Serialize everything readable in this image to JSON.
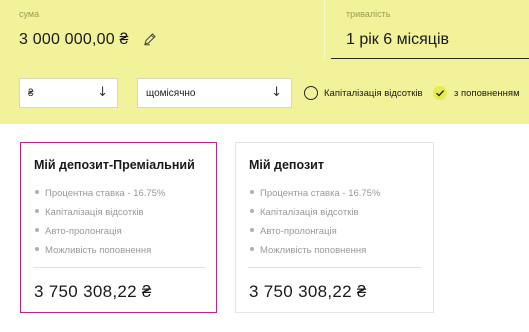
{
  "calculator": {
    "amount_label": "сума",
    "amount_value": "3 000 000,00 ₴",
    "duration_label": "тривалість",
    "duration_value": "1 рік 6 місяців",
    "currency_select": "₴",
    "frequency_select": "щомісячно",
    "option_capitalization": "Капіталізація відсотків",
    "option_capitalization_checked": false,
    "option_replenishment": "з поповненням",
    "option_replenishment_checked": true
  },
  "cards": [
    {
      "title": "Мій депозит-Преміальний",
      "features": [
        "Процентна ставка - 16.75%",
        "Капіталізація відсотків",
        "Авто-пролонгація",
        "Можливість поповнення"
      ],
      "total": "3 750 308,22 ₴",
      "selected": true
    },
    {
      "title": "Мій депозит",
      "features": [
        "Процентна ставка - 16.75%",
        "Капіталізація відсотків",
        "Авто-пролонгація",
        "Можливість поповнення"
      ],
      "total": "3 750 308,22 ₴",
      "selected": false
    }
  ],
  "colors": {
    "panel_bg": "#f1f29a",
    "accent_check": "#e4ec52",
    "selected_border": "#c2248f"
  },
  "icons": {
    "edit": "pencil-icon",
    "dropdown": "arrow-down-icon",
    "checked": "check-icon"
  }
}
